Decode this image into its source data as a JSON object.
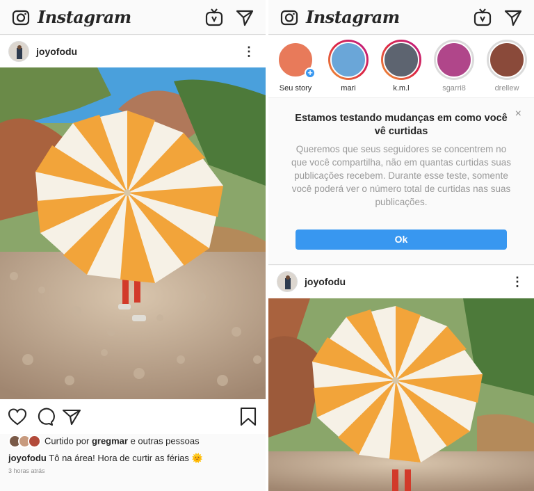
{
  "app": {
    "name": "Instagram"
  },
  "left": {
    "post": {
      "username": "joyofodu",
      "liked_by_prefix": "Curtido por",
      "liked_by_user": "gregmar",
      "liked_by_suffix": "e outras pessoas",
      "caption_user": "joyofodu",
      "caption_text": "Tô na área! Hora de curtir as férias",
      "caption_emoji": "🌞",
      "time_ago": "3 horas atrás"
    }
  },
  "right": {
    "stories": [
      {
        "label": "Seu story",
        "state": "own"
      },
      {
        "label": "mari",
        "state": "new"
      },
      {
        "label": "k.m.l",
        "state": "new"
      },
      {
        "label": "sgarri8",
        "state": "seen"
      },
      {
        "label": "drellew",
        "state": "seen"
      }
    ],
    "notice": {
      "title": "Estamos testando mudanças em como você vê curtidas",
      "body": "Queremos que seus seguidores se concentrem no que você compartilha, não em quantas curtidas suas publicações recebem. Durante esse teste, somente você poderá ver o número total de curtidas nas suas publicações.",
      "button": "Ok",
      "close": "×"
    },
    "post": {
      "username": "joyofodu"
    }
  },
  "icons": {
    "camera": "camera-icon",
    "igtv": "igtv-icon",
    "direct": "direct-message-icon",
    "more": "more-options-icon",
    "like": "heart-icon",
    "comment": "comment-icon",
    "share": "share-icon",
    "save": "bookmark-icon"
  },
  "colors": {
    "accent": "#3897f0",
    "text": "#262626",
    "muted": "#8e8e8e",
    "umbrella_stripe": "#f2a43a"
  }
}
